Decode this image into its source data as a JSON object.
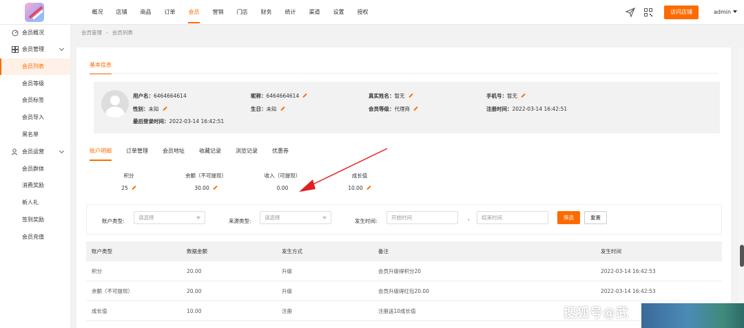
{
  "topnav": {
    "items": [
      "概况",
      "店铺",
      "商品",
      "订单",
      "会员",
      "营销",
      "门店",
      "财务",
      "统计",
      "渠道",
      "设置",
      "授权"
    ],
    "active_index": 4,
    "visit_button": "访问店铺",
    "user": "admin"
  },
  "sidebar": {
    "items": [
      {
        "label": "会员概况",
        "icon": "dashboard-icon"
      },
      {
        "label": "会员管理",
        "icon": "grid-icon"
      },
      {
        "label": "会员列表"
      },
      {
        "label": "会员等级"
      },
      {
        "label": "会员标签"
      },
      {
        "label": "会员导入"
      },
      {
        "label": "黑名单"
      },
      {
        "label": "会员运营",
        "icon": "user-icon"
      },
      {
        "label": "会员群体"
      },
      {
        "label": "消费奖励"
      },
      {
        "label": "新人礼"
      },
      {
        "label": "签到奖励"
      },
      {
        "label": "会员充值"
      }
    ]
  },
  "breadcrumb": [
    "会员管理",
    "-",
    "会员列表"
  ],
  "basic_tab": "基本信息",
  "member": {
    "username_label": "用户名：",
    "username": "6464664614",
    "nickname_label": "昵称：",
    "nickname": "6464664614",
    "realname_label": "真实姓名：",
    "realname": "暂无",
    "phone_label": "手机号：",
    "phone": "暂无",
    "gender_label": "性别：",
    "gender": "未知",
    "birthday_label": "生日：",
    "birthday": "未知",
    "level_label": "会员等级：",
    "level": "代理商",
    "regtime_label": "注册时间：",
    "regtime": "2022-03-14 16:42:51",
    "lastlogin_label": "最后登录时间：",
    "lastlogin": "2022-03-14 16:42:51"
  },
  "subtabs": [
    "账户明细",
    "订单管理",
    "会员地址",
    "收藏记录",
    "浏览记录",
    "优惠券"
  ],
  "stats": [
    {
      "label": "积分",
      "value": "25"
    },
    {
      "label": "余额（不可提现）",
      "value": "30.00"
    },
    {
      "label": "收入（可提现）",
      "value": "0.00"
    },
    {
      "label": "成长值",
      "value": "10.00"
    }
  ],
  "filter": {
    "account_type_label": "账户类型:",
    "account_type_placeholder": "请选择",
    "source_type_label": "来源类型:",
    "source_type_placeholder": "请选择",
    "time_label": "发生时间:",
    "start_placeholder": "开始时间",
    "dash": "-",
    "end_placeholder": "结束时间",
    "filter_button": "筛选",
    "reset_button": "重置"
  },
  "table": {
    "headers": [
      "账户类型",
      "数据金额",
      "发生方式",
      "备注",
      "发生时间"
    ],
    "rows": [
      [
        "积分",
        "20.00",
        "升级",
        "会员升级得积分20",
        "2022-03-14 16:42:53"
      ],
      [
        "余额（不可提现）",
        "20.00",
        "升级",
        "会员升级得红包20.00",
        "2022-03-14 16:42:53"
      ],
      [
        "成长值",
        "10.00",
        "注册",
        "注册送10成长值",
        ""
      ]
    ]
  },
  "watermark": "搜狐号@武",
  "colors": {
    "accent": "#ff6a00",
    "bg": "#f2f2f2"
  }
}
